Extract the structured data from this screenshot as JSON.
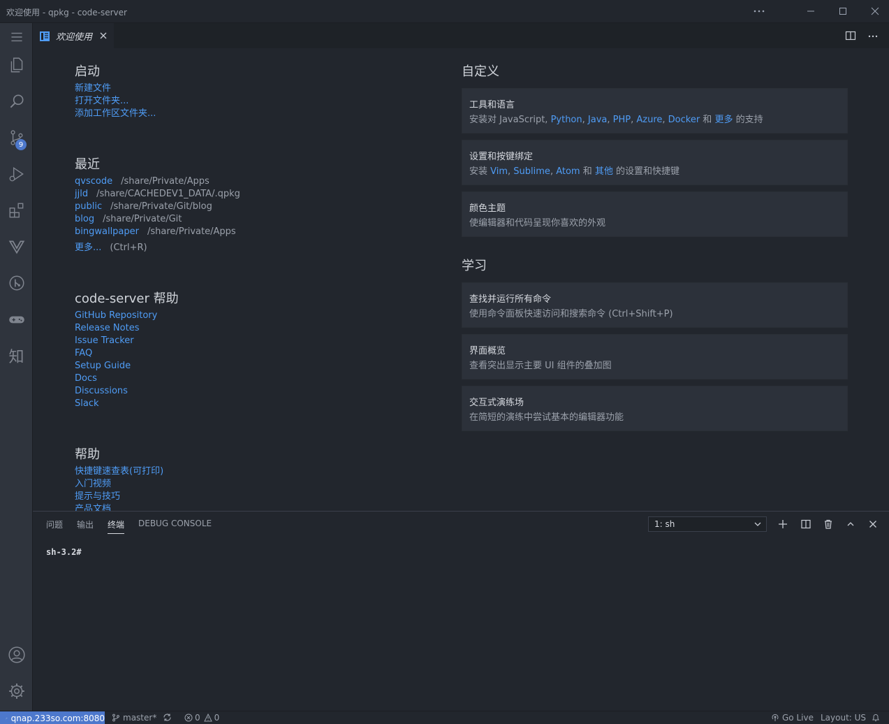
{
  "window": {
    "title": "欢迎使用 - qpkg - code-server"
  },
  "activity": {
    "scm_badge": "9",
    "zhi_label": "知"
  },
  "tab": {
    "label": "欢迎使用"
  },
  "welcome": {
    "start": {
      "heading": "启动",
      "links": [
        "新建文件",
        "打开文件夹...",
        "添加工作区文件夹..."
      ]
    },
    "recent": {
      "heading": "最近",
      "items": [
        {
          "name": "qvscode",
          "path": "/share/Private/Apps"
        },
        {
          "name": "jjld",
          "path": "/share/CACHEDEV1_DATA/.qpkg"
        },
        {
          "name": "public",
          "path": "/share/Private/Git/blog"
        },
        {
          "name": "blog",
          "path": "/share/Private/Git"
        },
        {
          "name": "bingwallpaper",
          "path": "/share/Private/Apps"
        }
      ],
      "more_label": "更多...",
      "more_shortcut": "(Ctrl+R)"
    },
    "cs_help": {
      "heading": "code-server 帮助",
      "links": [
        "GitHub Repository",
        "Release Notes",
        "Issue Tracker",
        "FAQ",
        "Setup Guide",
        "Docs",
        "Discussions",
        "Slack"
      ]
    },
    "help": {
      "heading": "帮助",
      "links": [
        "快捷键速查表(可打印)",
        "入门视频",
        "提示与技巧",
        "产品文档"
      ]
    },
    "customize": {
      "heading": "自定义",
      "tools": {
        "title": "工具和语言",
        "prefix": "安装对 JavaScript, ",
        "python": "Python",
        "java": "Java",
        "php": "PHP",
        "azure": "Azure",
        "docker": "Docker",
        "and": " 和 ",
        "more": "更多",
        "suffix": " 的支持"
      },
      "keys": {
        "title": "设置和按键绑定",
        "prefix": "安装 ",
        "vim": "Vim",
        "sublime": "Sublime",
        "atom": "Atom",
        "and": " 和 ",
        "other": "其他",
        "suffix": " 的设置和快捷键"
      },
      "theme": {
        "title": "颜色主题",
        "desc": "使编辑器和代码呈现你喜欢的外观"
      }
    },
    "learn": {
      "heading": "学习",
      "cards": [
        {
          "title": "查找并运行所有命令",
          "desc": "使用命令面板快速访问和搜索命令 (Ctrl+Shift+P)"
        },
        {
          "title": "界面概览",
          "desc": "查看突出显示主要 UI 组件的叠加图"
        },
        {
          "title": "交互式演练场",
          "desc": "在简短的演练中尝试基本的编辑器功能"
        }
      ]
    }
  },
  "panel": {
    "tabs": [
      "问题",
      "输出",
      "终端",
      "DEBUG CONSOLE"
    ],
    "terminal_select": "1: sh",
    "prompt": "sh-3.2#"
  },
  "status": {
    "remote": "qnap.233so.com:8080",
    "branch": "master*",
    "errors": "0",
    "warnings": "0",
    "golive": "Go Live",
    "layout": "Layout: US"
  },
  "colors": {
    "accent": "#4d78cc",
    "link": "#4f9cf5",
    "bg": "#22262d",
    "activity_bg": "#2f343d"
  }
}
